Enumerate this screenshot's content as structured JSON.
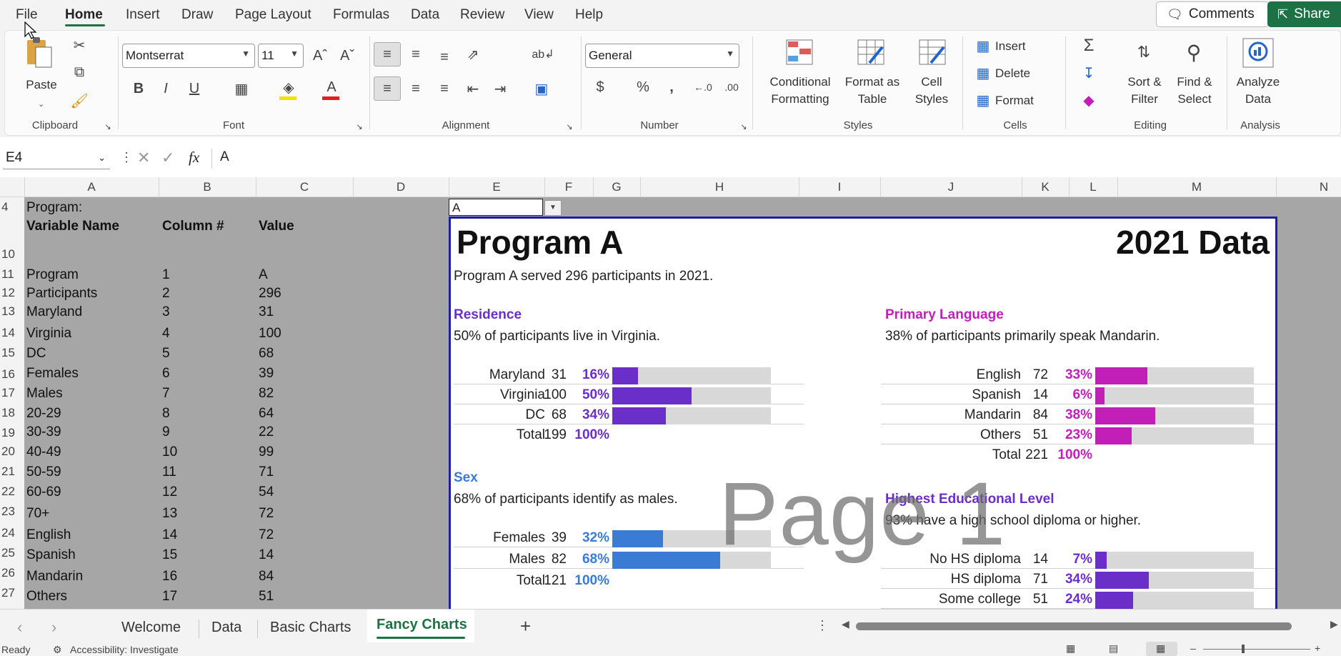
{
  "menu": {
    "items": [
      "File",
      "Home",
      "Insert",
      "Draw",
      "Page Layout",
      "Formulas",
      "Data",
      "Review",
      "View",
      "Help"
    ],
    "active": "Home",
    "comments_label": "Comments",
    "share_label": "Share"
  },
  "ribbon": {
    "clipboard": {
      "label": "Clipboard",
      "paste": "Paste"
    },
    "font": {
      "label": "Font",
      "family": "Montserrat",
      "size": "11"
    },
    "alignment": {
      "label": "Alignment"
    },
    "number": {
      "label": "Number",
      "format": "General"
    },
    "styles": {
      "label": "Styles",
      "conditional_1": "Conditional",
      "conditional_2": "Formatting",
      "format_table_1": "Format as",
      "format_table_2": "Table",
      "cell_styles_1": "Cell",
      "cell_styles_2": "Styles"
    },
    "cells": {
      "label": "Cells",
      "insert": "Insert",
      "delete": "Delete",
      "format": "Format"
    },
    "editing": {
      "label": "Editing",
      "sort_1": "Sort &",
      "sort_2": "Filter",
      "find_1": "Find &",
      "find_2": "Select"
    },
    "analysis": {
      "label": "Analysis",
      "analyze_1": "Analyze",
      "analyze_2": "Data"
    }
  },
  "formula_bar": {
    "name_box": "E4",
    "content": "A"
  },
  "columns": [
    "A",
    "B",
    "C",
    "D",
    "E",
    "F",
    "G",
    "H",
    "I",
    "J",
    "K",
    "L",
    "M",
    "N"
  ],
  "rows": [
    "4",
    "10",
    "11",
    "12",
    "13",
    "14",
    "15",
    "16",
    "17",
    "18",
    "19",
    "20",
    "21",
    "22",
    "23",
    "24",
    "25",
    "26",
    "27"
  ],
  "left_table": {
    "program_label": "Program:",
    "headers": [
      "Variable Name",
      "Column #",
      "Value"
    ],
    "rows": [
      [
        "Program",
        "1",
        "A"
      ],
      [
        "Participants",
        "2",
        "296"
      ],
      [
        "Maryland",
        "3",
        "31"
      ],
      [
        "Virginia",
        "4",
        "100"
      ],
      [
        "DC",
        "5",
        "68"
      ],
      [
        "Females",
        "6",
        "39"
      ],
      [
        "Males",
        "7",
        "82"
      ],
      [
        "20-29",
        "8",
        "64"
      ],
      [
        "30-39",
        "9",
        "22"
      ],
      [
        "40-49",
        "10",
        "99"
      ],
      [
        "50-59",
        "11",
        "71"
      ],
      [
        "60-69",
        "12",
        "54"
      ],
      [
        "70+",
        "13",
        "72"
      ],
      [
        "English",
        "14",
        "72"
      ],
      [
        "Spanish",
        "15",
        "14"
      ],
      [
        "Mandarin",
        "16",
        "84"
      ],
      [
        "Others",
        "17",
        "51"
      ]
    ]
  },
  "dashboard": {
    "e4_value": "A",
    "title": "Program A",
    "year_label": "2021 Data",
    "summary": "Program A served 296 participants in 2021.",
    "watermark": "Page 1",
    "sections": {
      "residence": {
        "title": "Residence",
        "subtitle": "50% of participants live in Virginia.",
        "color": "#6a2fc9",
        "rows": [
          {
            "label": "Maryland",
            "count": "31",
            "pct": "16%",
            "value": 0.16
          },
          {
            "label": "Virginia",
            "count": "100",
            "pct": "50%",
            "value": 0.5
          },
          {
            "label": "DC",
            "count": "68",
            "pct": "34%",
            "value": 0.34
          }
        ],
        "total": {
          "label": "Total",
          "count": "199",
          "pct": "100%"
        }
      },
      "sex": {
        "title": "Sex",
        "subtitle": "68% of participants identify as males.",
        "color": "#3a7bd5",
        "rows": [
          {
            "label": "Females",
            "count": "39",
            "pct": "32%",
            "value": 0.32
          },
          {
            "label": "Males",
            "count": "82",
            "pct": "68%",
            "value": 0.68
          }
        ],
        "total": {
          "label": "Total",
          "count": "121",
          "pct": "100%"
        }
      },
      "language": {
        "title": "Primary Language",
        "subtitle": "38% of participants primarily speak Mandarin.",
        "color": "#c21fb8",
        "rows": [
          {
            "label": "English",
            "count": "72",
            "pct": "33%",
            "value": 0.33
          },
          {
            "label": "Spanish",
            "count": "14",
            "pct": "6%",
            "value": 0.06
          },
          {
            "label": "Mandarin",
            "count": "84",
            "pct": "38%",
            "value": 0.38
          },
          {
            "label": "Others",
            "count": "51",
            "pct": "23%",
            "value": 0.23
          }
        ],
        "total": {
          "label": "Total",
          "count": "221",
          "pct": "100%"
        }
      },
      "education": {
        "title": "Highest Educational Level",
        "subtitle": "93% have a high school diploma or higher.",
        "color": "#6a2fc9",
        "rows": [
          {
            "label": "No HS diploma",
            "count": "14",
            "pct": "7%",
            "value": 0.07
          },
          {
            "label": "HS diploma",
            "count": "71",
            "pct": "34%",
            "value": 0.34
          },
          {
            "label": "Some college",
            "count": "51",
            "pct": "24%",
            "value": 0.24
          }
        ]
      }
    }
  },
  "sheet_tabs": [
    "Welcome",
    "Data",
    "Basic Charts",
    "Fancy Charts"
  ],
  "active_sheet": "Fancy Charts",
  "status": {
    "ready": "Ready",
    "accessibility": "Accessibility: Investigate"
  },
  "colors": {
    "accent": "#1e7145",
    "purple": "#6a2fc9",
    "blue": "#3a7bd5",
    "magenta": "#c21fb8"
  }
}
